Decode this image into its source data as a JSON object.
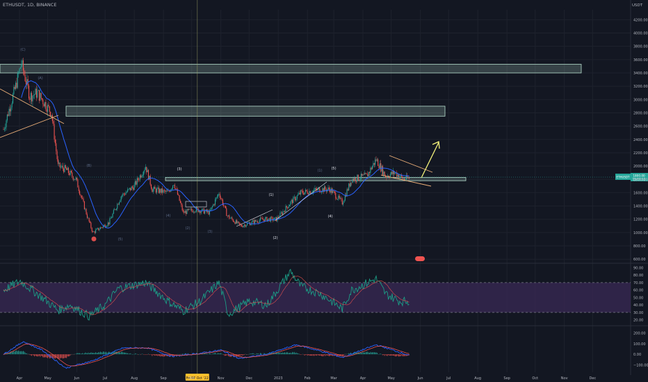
{
  "symbol_line": "ETHUSDT, 1D, BINANCE",
  "currency": "USDT",
  "colors": {
    "bg": "#131722",
    "grid": "#1e222d",
    "up": "#26a69a",
    "down": "#ef5350",
    "ma": "#2962ff",
    "rsi": "#1b9e86",
    "rsi_ma": "#ef5350",
    "rsi_band": "#3a2a55",
    "zone": "#b8e0cf",
    "trend": "#f0b27a",
    "arrow": "#f4f27a",
    "crosshair": "#aab06a"
  },
  "price_labels": [
    "4200.00",
    "4000.00",
    "3800.00",
    "3600.00",
    "3400.00",
    "3200.00",
    "3000.00",
    "2800.00",
    "2600.00",
    "2400.00",
    "2200.00",
    "2000.00",
    "1800.00",
    "1600.00",
    "1400.00",
    "1200.00",
    "1000.00",
    "800.00",
    "600.00"
  ],
  "rsi_labels": [
    "90.00",
    "80.00",
    "70.00",
    "60.00",
    "50.00",
    "40.00",
    "30.00",
    "20.00"
  ],
  "macd_labels": [
    "200.00",
    "100.00",
    "0.00",
    "−100.00"
  ],
  "time_labels": [
    "Apr",
    "May",
    "Jun",
    "Jul",
    "Aug",
    "Sep",
    "Oct",
    "Nov",
    "Dec",
    "2023",
    "Feb",
    "Mar",
    "Apr",
    "May",
    "Jun",
    "Jul",
    "Aug",
    "Sep",
    "Oct",
    "Nov",
    "Dec"
  ],
  "crosshair_date": "Fri 07 Oct '22",
  "last_price": "ETHUSDT",
  "last_price_value": "1800.00",
  "last_price_countdown": "15:10:10",
  "wave_labels": [
    "(1)",
    "(2)",
    "(3)",
    "(4)",
    "(5)",
    "(1)",
    "(2)",
    "(3)",
    "(4)",
    "(5)",
    "(A)",
    "(B)",
    "(C)"
  ],
  "chart_data": {
    "type": "candlestick",
    "title": "ETHUSDT, 1D, BINANCE",
    "ylim": [
      550,
      4350
    ],
    "price_levels": [
      4200,
      4000,
      3800,
      3600,
      3400,
      3200,
      3000,
      2800,
      2600,
      2400,
      2200,
      2000,
      1800,
      1600,
      1400,
      1200,
      1000,
      800,
      600
    ],
    "path": [
      [
        "2022-03-15",
        2550
      ],
      [
        "2022-03-28",
        3200
      ],
      [
        "2022-04-03",
        3550
      ],
      [
        "2022-04-12",
        3050
      ],
      [
        "2022-04-20",
        3100
      ],
      [
        "2022-05-05",
        2800
      ],
      [
        "2022-05-12",
        2000
      ],
      [
        "2022-05-20",
        1950
      ],
      [
        "2022-05-31",
        1800
      ],
      [
        "2022-06-13",
        1200
      ],
      [
        "2022-06-18",
        1000
      ],
      [
        "2022-07-05",
        1150
      ],
      [
        "2022-07-18",
        1550
      ],
      [
        "2022-08-01",
        1700
      ],
      [
        "2022-08-13",
        2000
      ],
      [
        "2022-08-20",
        1650
      ],
      [
        "2022-09-06",
        1600
      ],
      [
        "2022-09-12",
        1750
      ],
      [
        "2022-09-22",
        1300
      ],
      [
        "2022-10-05",
        1350
      ],
      [
        "2022-10-20",
        1300
      ],
      [
        "2022-10-30",
        1600
      ],
      [
        "2022-11-08",
        1250
      ],
      [
        "2022-11-22",
        1100
      ],
      [
        "2022-12-15",
        1200
      ],
      [
        "2022-12-30",
        1200
      ],
      [
        "2023-01-14",
        1450
      ],
      [
        "2023-01-25",
        1600
      ],
      [
        "2023-02-15",
        1650
      ],
      [
        "2023-02-25",
        1650
      ],
      [
        "2023-03-10",
        1450
      ],
      [
        "2023-03-20",
        1800
      ],
      [
        "2023-04-05",
        1850
      ],
      [
        "2023-04-15",
        2100
      ],
      [
        "2023-04-25",
        1850
      ],
      [
        "2023-05-05",
        1900
      ],
      [
        "2023-05-15",
        1800
      ],
      [
        "2023-05-20",
        1820
      ]
    ],
    "zones": [
      [
        3400,
        3530
      ],
      [
        2750,
        2900
      ],
      [
        1780,
        1830
      ]
    ],
    "rsi": {
      "levels": [
        70,
        30
      ],
      "ylim": [
        15,
        95
      ],
      "path": [
        [
          "2022-03-15",
          60
        ],
        [
          "2022-04-02",
          72
        ],
        [
          "2022-04-20",
          55
        ],
        [
          "2022-05-12",
          33
        ],
        [
          "2022-05-25",
          40
        ],
        [
          "2022-06-14",
          25
        ],
        [
          "2022-07-01",
          40
        ],
        [
          "2022-07-15",
          62
        ],
        [
          "2022-08-13",
          70
        ],
        [
          "2022-09-06",
          45
        ],
        [
          "2022-09-22",
          32
        ],
        [
          "2022-10-10",
          45
        ],
        [
          "2022-10-30",
          70
        ],
        [
          "2022-11-09",
          28
        ],
        [
          "2022-12-01",
          45
        ],
        [
          "2022-12-20",
          40
        ],
        [
          "2023-01-14",
          85
        ],
        [
          "2023-01-25",
          65
        ],
        [
          "2023-02-15",
          55
        ],
        [
          "2023-03-10",
          35
        ],
        [
          "2023-03-20",
          60
        ],
        [
          "2023-04-15",
          75
        ],
        [
          "2023-04-25",
          55
        ],
        [
          "2023-05-10",
          45
        ],
        [
          "2023-05-20",
          45
        ]
      ]
    },
    "macd": {
      "ylim": [
        -170,
        250
      ],
      "path": [
        [
          "2022-03-15",
          0
        ],
        [
          "2022-04-05",
          120
        ],
        [
          "2022-04-25",
          40
        ],
        [
          "2022-05-20",
          -130
        ],
        [
          "2022-06-18",
          -60
        ],
        [
          "2022-07-20",
          60
        ],
        [
          "2022-08-15",
          60
        ],
        [
          "2022-09-10",
          -20
        ],
        [
          "2022-10-10",
          10
        ],
        [
          "2022-11-01",
          40
        ],
        [
          "2022-11-20",
          -40
        ],
        [
          "2022-12-20",
          0
        ],
        [
          "2023-01-20",
          90
        ],
        [
          "2023-02-15",
          30
        ],
        [
          "2023-03-10",
          -30
        ],
        [
          "2023-04-15",
          90
        ],
        [
          "2023-05-20",
          -10
        ]
      ]
    }
  }
}
